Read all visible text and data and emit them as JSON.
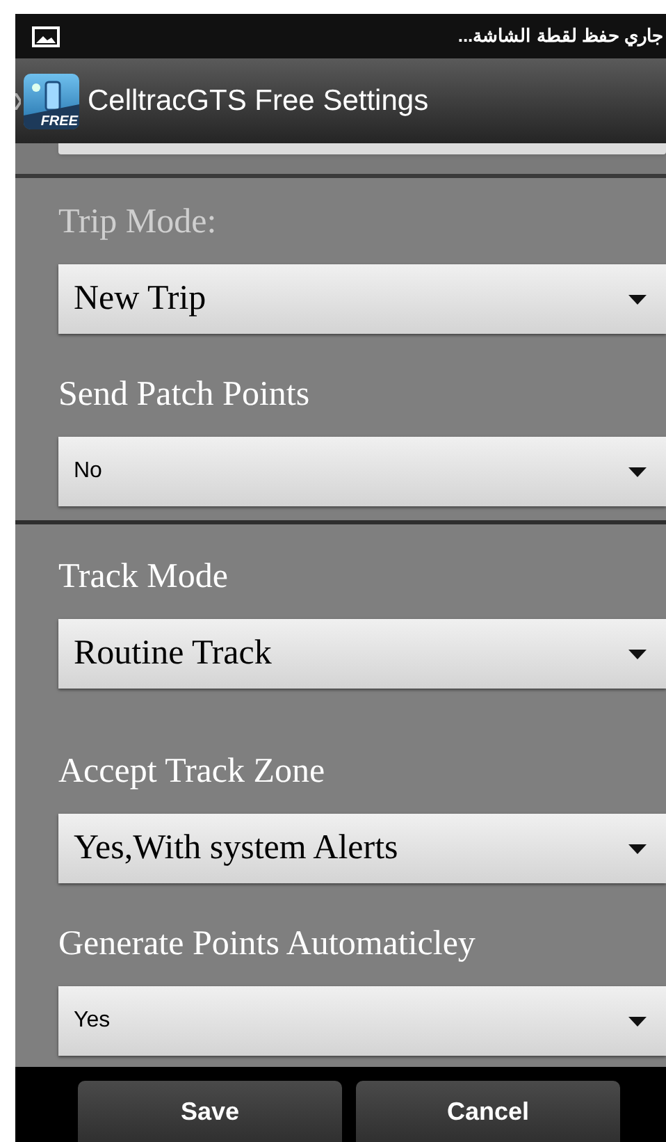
{
  "status_bar": {
    "notification": "جاري حفظ لقطة الشاشة..."
  },
  "action_bar": {
    "title": "CelltracGTS Free Settings",
    "badge": "FREE"
  },
  "sections": [
    {
      "settings": [
        {
          "label": "Trip  Mode:",
          "dimmed": true,
          "value": "New Trip",
          "kind": "serif"
        },
        {
          "label": "Send Patch Points",
          "dimmed": false,
          "value": "No",
          "kind": "sans"
        }
      ]
    },
    {
      "settings": [
        {
          "label": "Track Mode",
          "dimmed": false,
          "value": "Routine Track",
          "kind": "serif"
        },
        {
          "label": "Accept Track Zone",
          "dimmed": false,
          "value": "Yes,With system Alerts",
          "kind": "serif"
        },
        {
          "label": "Generate Points Automaticley",
          "dimmed": false,
          "value": "Yes",
          "kind": "sans"
        }
      ]
    }
  ],
  "buttons": [
    "Save",
    "Cancel"
  ]
}
